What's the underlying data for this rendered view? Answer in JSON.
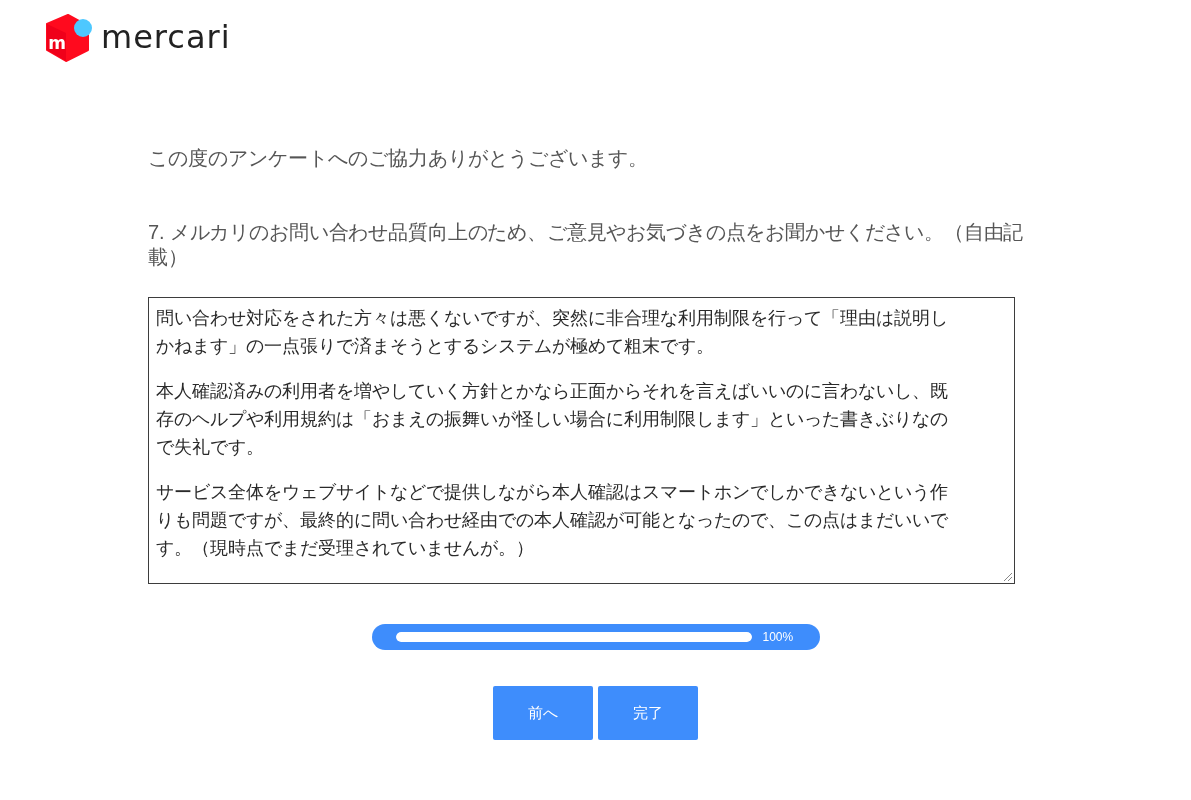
{
  "logo": {
    "mark": "m",
    "wordmark": "mercari"
  },
  "intro": "この度のアンケートへのご協力ありがとうございます。",
  "question": {
    "label": "7. メルカリのお問い合わせ品質向上のため、ご意見やお気づきの点をお聞かせください。（自由記載）",
    "answer": [
      "問い合わせ対応をされた方々は悪くないですが、突然に非合理な利用制限を行って「理由は説明しかねます」の一点張りで済まそうとするシステムが極めて粗末です。",
      "本人確認済みの利用者を増やしていく方針とかなら正面からそれを言えばいいのに言わないし、既存のヘルプや利用規約は「おまえの振舞いが怪しい場合に利用制限します」といった書きぶりなので失礼です。",
      "サービス全体をウェブサイトなどで提供しながら本人確認はスマートホンでしかできないという作りも問題ですが、最終的に問い合わせ経由での本人確認が可能となったので、この点はまだいいです。（現時点でまだ受理されていませんが。）"
    ]
  },
  "progress": {
    "level": 1,
    "reading": "100%"
  },
  "buttons": [
    "前へ",
    "完了"
  ]
}
